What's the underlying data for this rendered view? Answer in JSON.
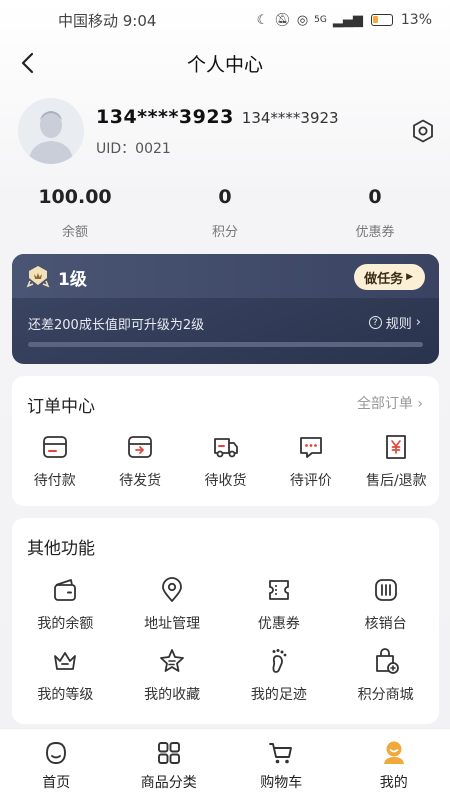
{
  "status_bar": {
    "carrier_time": "中国移动 9:04",
    "network": "5G",
    "battery_pct": "13%"
  },
  "nav": {
    "title": "个人中心"
  },
  "profile": {
    "name": "134****3923",
    "phone": "134****3923",
    "uid_label": "UID：",
    "uid_value": "0021"
  },
  "stats": [
    {
      "value": "100.00",
      "label": "余额"
    },
    {
      "value": "0",
      "label": "积分"
    },
    {
      "value": "0",
      "label": "优惠券"
    }
  ],
  "level": {
    "name": "1级",
    "task_button": "做任务",
    "hint": "还差200成长值即可升级为2级",
    "rule_label": "规则",
    "progress": 0
  },
  "orders": {
    "title": "订单中心",
    "all_link": "全部订单",
    "items": [
      {
        "label": "待付款",
        "icon": "wallet-card-icon"
      },
      {
        "label": "待发货",
        "icon": "box-send-icon"
      },
      {
        "label": "待收货",
        "icon": "truck-icon"
      },
      {
        "label": "待评价",
        "icon": "chat-bubble-icon"
      },
      {
        "label": "售后/退款",
        "icon": "yen-refund-icon"
      }
    ]
  },
  "functions": {
    "title": "其他功能",
    "items": [
      {
        "label": "我的余额",
        "icon": "wallet-icon"
      },
      {
        "label": "地址管理",
        "icon": "location-pin-icon"
      },
      {
        "label": "优惠券",
        "icon": "coupon-icon"
      },
      {
        "label": "核销台",
        "icon": "scan-counter-icon"
      },
      {
        "label": "我的等级",
        "icon": "crown-icon"
      },
      {
        "label": "我的收藏",
        "icon": "star-icon"
      },
      {
        "label": "我的足迹",
        "icon": "footprint-icon"
      },
      {
        "label": "积分商城",
        "icon": "points-bag-icon"
      }
    ]
  },
  "tabbar": {
    "items": [
      {
        "label": "首页",
        "icon": "home-icon"
      },
      {
        "label": "商品分类",
        "icon": "category-grid-icon"
      },
      {
        "label": "购物车",
        "icon": "cart-icon"
      },
      {
        "label": "我的",
        "icon": "profile-icon"
      }
    ],
    "active_color": "#f2a93b"
  }
}
